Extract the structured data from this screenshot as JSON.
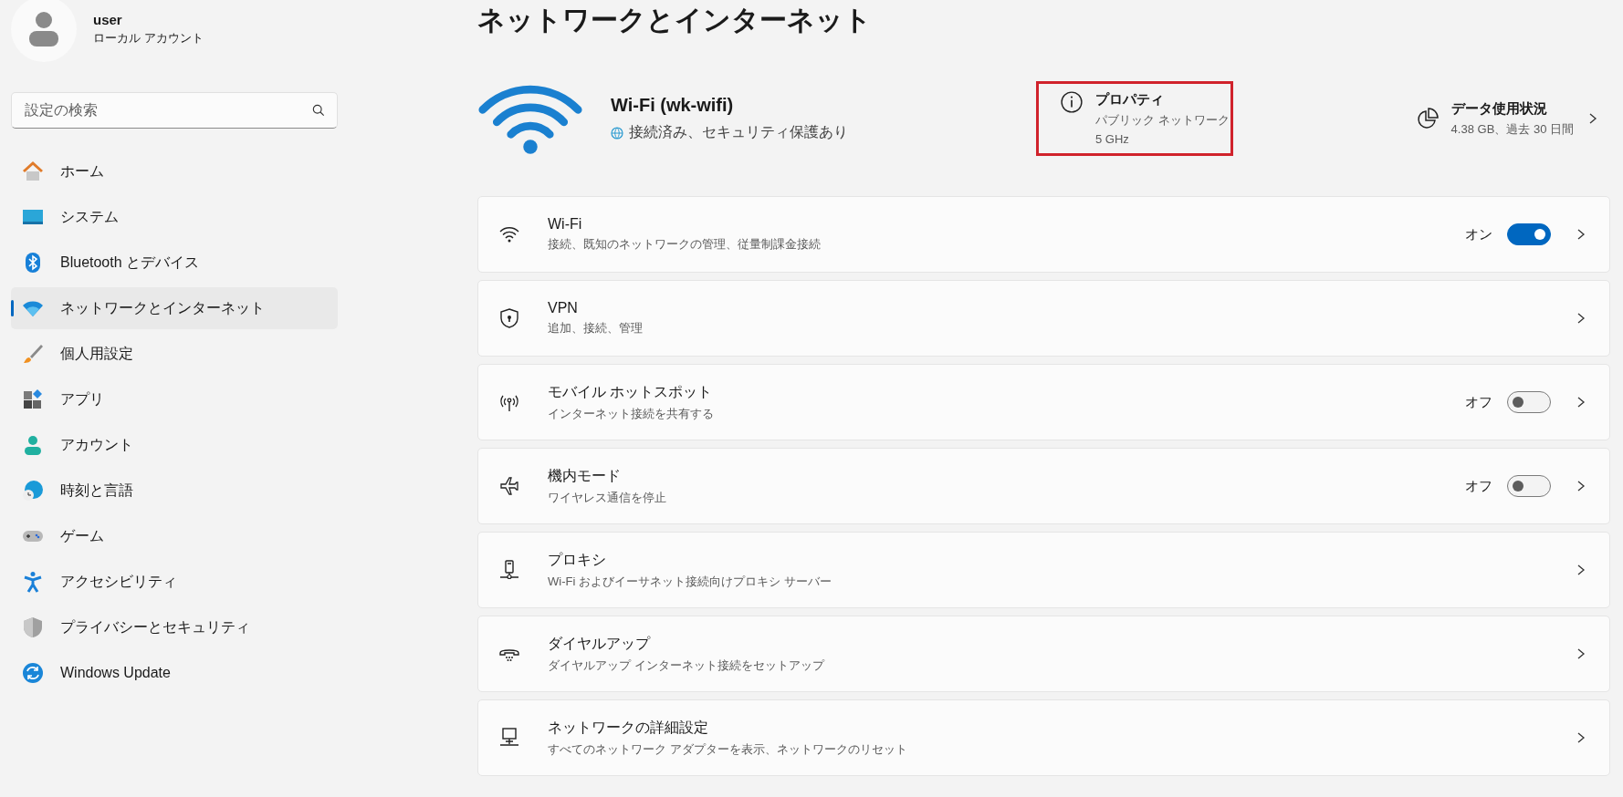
{
  "account": {
    "name": "user",
    "type": "ローカル アカウント"
  },
  "search": {
    "placeholder": "設定の検索"
  },
  "nav": [
    {
      "label": "ホーム",
      "selected": false
    },
    {
      "label": "システム",
      "selected": false
    },
    {
      "label": "Bluetooth とデバイス",
      "selected": false
    },
    {
      "label": "ネットワークとインターネット",
      "selected": true
    },
    {
      "label": "個人用設定",
      "selected": false
    },
    {
      "label": "アプリ",
      "selected": false
    },
    {
      "label": "アカウント",
      "selected": false
    },
    {
      "label": "時刻と言語",
      "selected": false
    },
    {
      "label": "ゲーム",
      "selected": false
    },
    {
      "label": "アクセシビリティ",
      "selected": false
    },
    {
      "label": "プライバシーとセキュリティ",
      "selected": false
    },
    {
      "label": "Windows Update",
      "selected": false
    }
  ],
  "page_title": "ネットワークとインターネット",
  "connection": {
    "name": "Wi-Fi (wk-wifi)",
    "status": "接続済み、セキュリティ保護あり"
  },
  "properties": {
    "title": "プロパティ",
    "lines": [
      "パブリック ネットワーク",
      "5 GHz"
    ],
    "highlighted": true
  },
  "data_usage": {
    "title": "データ使用状況",
    "detail": "4.38 GB、過去 30 日間"
  },
  "settings": [
    {
      "title": "Wi-Fi",
      "subtitle": "接続、既知のネットワークの管理、従量制課金接続",
      "toggle": {
        "on": true,
        "label": "オン"
      }
    },
    {
      "title": "VPN",
      "subtitle": "追加、接続、管理"
    },
    {
      "title": "モバイル ホットスポット",
      "subtitle": "インターネット接続を共有する",
      "toggle": {
        "on": false,
        "label": "オフ"
      }
    },
    {
      "title": "機内モード",
      "subtitle": "ワイヤレス通信を停止",
      "toggle": {
        "on": false,
        "label": "オフ"
      }
    },
    {
      "title": "プロキシ",
      "subtitle": "Wi-Fi およびイーサネット接続向けプロキシ サーバー"
    },
    {
      "title": "ダイヤルアップ",
      "subtitle": "ダイヤルアップ インターネット接続をセットアップ"
    },
    {
      "title": "ネットワークの詳細設定",
      "subtitle": "すべてのネットワーク アダプターを表示、ネットワークのリセット"
    }
  ]
}
